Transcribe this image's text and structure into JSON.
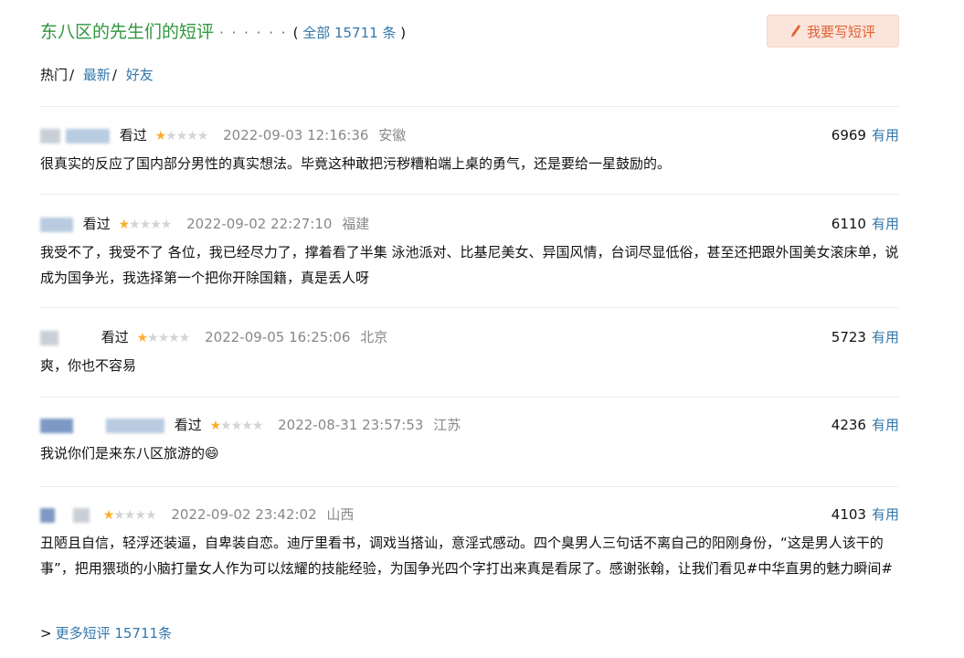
{
  "header": {
    "title": "东八区的先生们的短评",
    "dots": "· · · · · ·",
    "count_open": "( ",
    "count_link": "全部 15711 条",
    "count_close": " )",
    "write_button": "我要写短评",
    "write_icon": "pencil-icon"
  },
  "sort": {
    "hot": "热门",
    "latest": "最新",
    "friends": "好友",
    "separator": "/"
  },
  "reviews": [
    {
      "status": "看过",
      "rating": 1,
      "time": "2022-09-03 12:16:36",
      "location": "安徽",
      "votes": "6969",
      "useful": "有用",
      "text": "很真实的反应了国内部分男性的真实想法。毕竟这种敢把污秽糟粕端上桌的勇气，还是要给一星鼓励的。"
    },
    {
      "status": "看过",
      "rating": 1,
      "time": "2022-09-02 22:27:10",
      "location": "福建",
      "votes": "6110",
      "useful": "有用",
      "text": "我受不了，我受不了 各位，我已经尽力了，撑着看了半集 泳池派对、比基尼美女、异国风情，台词尽显低俗，甚至还把跟外国美女滚床单，说成为国争光，我选择第一个把你开除国籍，真是丢人呀"
    },
    {
      "status": "看过",
      "rating": 1,
      "time": "2022-09-05 16:25:06",
      "location": "北京",
      "votes": "5723",
      "useful": "有用",
      "text": "爽，你也不容易"
    },
    {
      "status": "看过",
      "rating": 1,
      "time": "2022-08-31 23:57:53",
      "location": "江苏",
      "votes": "4236",
      "useful": "有用",
      "text": "我说你们是来东八区旅游的😄"
    },
    {
      "status": "",
      "rating": 1,
      "time": "2022-09-02 23:42:02",
      "location": "山西",
      "votes": "4103",
      "useful": "有用",
      "text": "丑陋且自信，轻浮还装逼，自卑装自恋。迪厅里看书，调戏当搭讪，意淫式感动。四个臭男人三句话不离自己的阳刚身份，“这是男人该干的事”，把用猥琐的小脑打量女人作为可以炫耀的技能经验，为国争光四个字打出来真是看尿了。感谢张翰，让我们看见#中华直男的魅力瞬间#"
    }
  ],
  "more": {
    "arrow": ">",
    "text": "更多短评 15711条"
  },
  "colors": {
    "title_green": "#2e963d",
    "link_blue": "#3377aa",
    "star_on": "#ffac2d",
    "star_off": "#d4d4d4",
    "button_bg": "#fbe4dc",
    "button_text": "#e06233"
  }
}
